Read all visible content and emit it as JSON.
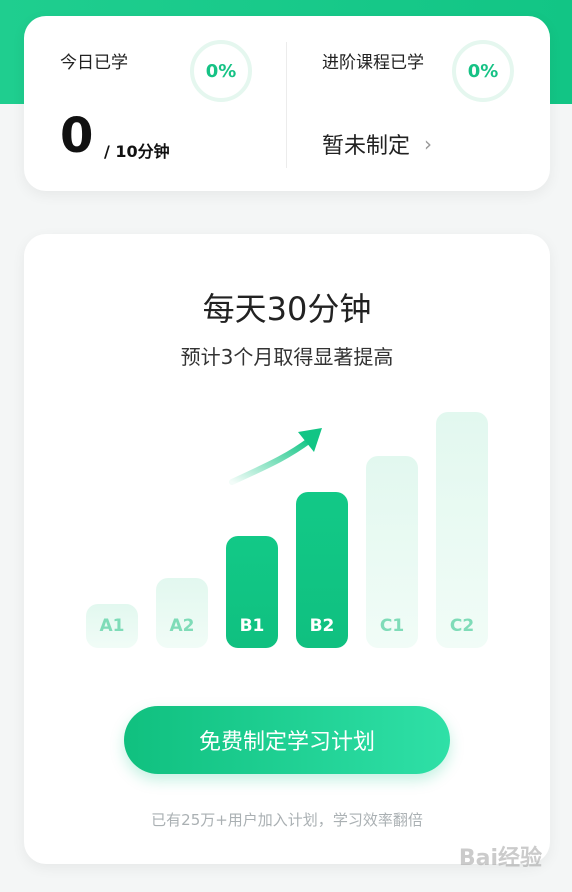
{
  "stats": {
    "today_label": "今日已学",
    "today_percent": "0%",
    "today_minutes": "0",
    "today_goal": "/ 10分钟",
    "advanced_label": "进阶课程已学",
    "advanced_percent": "0%",
    "advanced_status": "暂未制定",
    "chevron": "›"
  },
  "plan": {
    "headline": "每天30分钟",
    "subline": "预计3个月取得显著提高",
    "levels": [
      {
        "label": "A1",
        "style": "light"
      },
      {
        "label": "A2",
        "style": "light"
      },
      {
        "label": "B1",
        "style": "solid"
      },
      {
        "label": "B2",
        "style": "solid"
      },
      {
        "label": "C1",
        "style": "light"
      },
      {
        "label": "C2",
        "style": "light"
      }
    ],
    "cta_label": "免费制定学习计划",
    "footnote": "已有25万+用户加入计划，学习效率翻倍"
  },
  "watermark": "Bai经验",
  "colors": {
    "accent": "#12c585",
    "bar_light": "#e2f8ef",
    "muted_text": "#aab0b3"
  }
}
